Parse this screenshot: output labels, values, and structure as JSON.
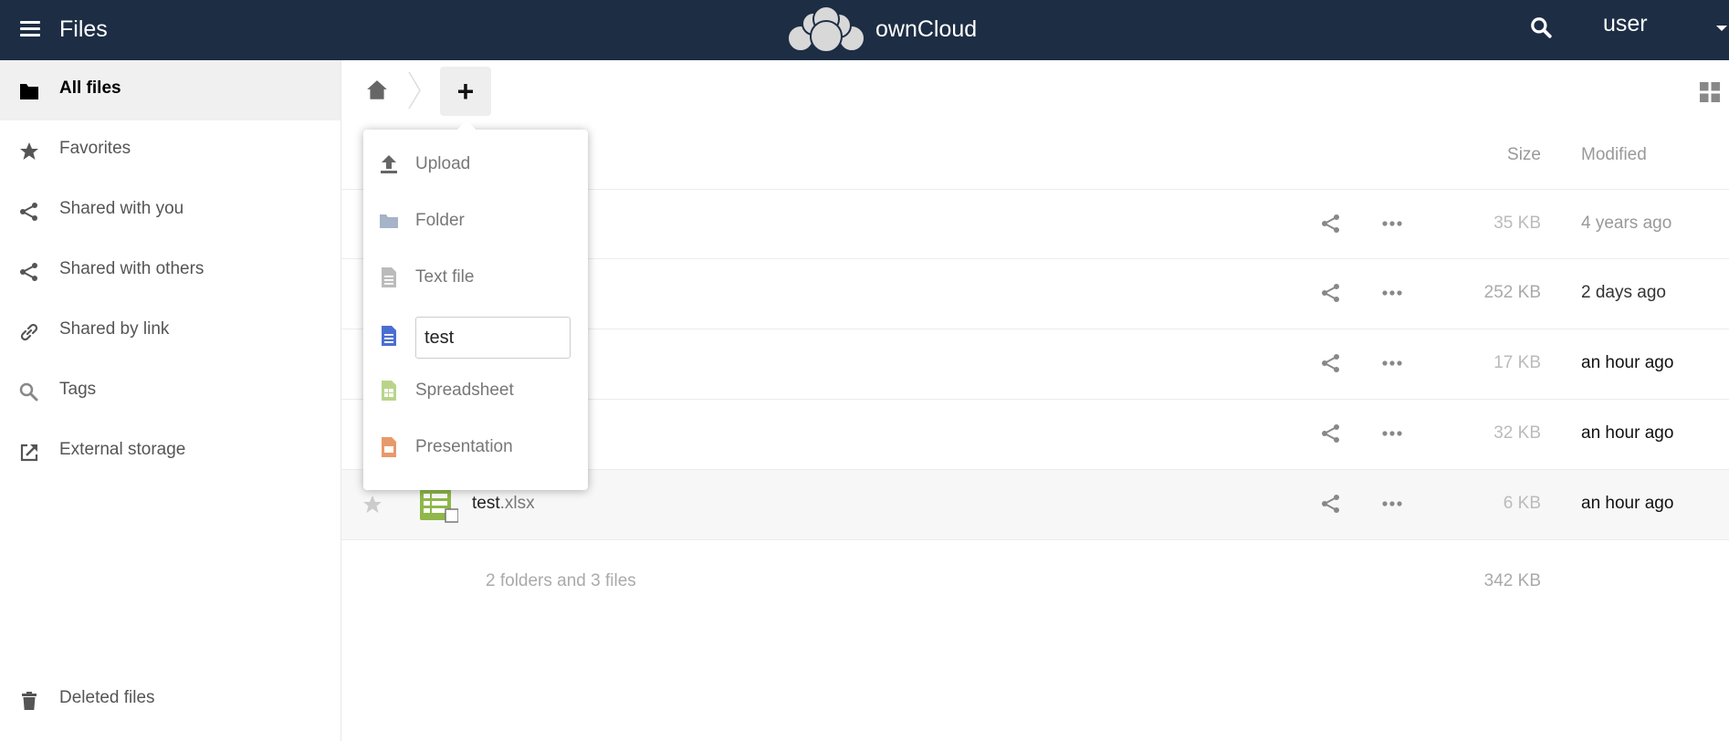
{
  "header": {
    "app_title": "Files",
    "logo_text": "ownCloud",
    "user_name": "user",
    "bg_color": "#1d2d44"
  },
  "sidebar": {
    "items": [
      {
        "label": "All files",
        "icon": "folder-icon",
        "active": true
      },
      {
        "label": "Favorites",
        "icon": "star-icon"
      },
      {
        "label": "Shared with you",
        "icon": "share-icon"
      },
      {
        "label": "Shared with others",
        "icon": "share-icon"
      },
      {
        "label": "Shared by link",
        "icon": "link-icon"
      },
      {
        "label": "Tags",
        "icon": "tag-search-icon"
      },
      {
        "label": "External storage",
        "icon": "external-icon"
      }
    ],
    "bottom_item": {
      "label": "Deleted files",
      "icon": "trash-icon"
    }
  },
  "controls": {
    "new_button_label": "+"
  },
  "table": {
    "col_size": "Size",
    "col_modified": "Modified",
    "rows": [
      {
        "name": "",
        "ext": "",
        "size": "35 KB",
        "modified": "4 years ago"
      },
      {
        "name": "",
        "ext": "",
        "size": "252 KB",
        "modified": "2 days ago"
      },
      {
        "name": "",
        "ext": "",
        "size": "17 KB",
        "modified": "an hour ago"
      },
      {
        "name": "",
        "ext": "",
        "size": "32 KB",
        "modified": "an hour ago"
      },
      {
        "name": "test",
        "ext": ".xlsx",
        "size": "6 KB",
        "modified": "an hour ago",
        "icon": "spreadsheet-icon"
      }
    ],
    "summary_text": "2 folders and 3 files",
    "summary_size": "342 KB"
  },
  "new_menu": {
    "items": [
      {
        "label": "Upload",
        "icon": "upload-icon"
      },
      {
        "label": "Folder",
        "icon": "folder-icon"
      },
      {
        "label": "Text file",
        "icon": "text-file-icon"
      },
      {
        "label": "",
        "icon": "document-icon",
        "input_value": "test"
      },
      {
        "label": "Spreadsheet",
        "icon": "spreadsheet-icon"
      },
      {
        "label": "Presentation",
        "icon": "presentation-icon"
      }
    ]
  },
  "colors": {
    "document_blue": "#4a6fd1",
    "spreadsheet_green": "#8fb74a",
    "presentation_orange": "#e8996a",
    "folder_gray_blue": "#a6b3c8"
  }
}
